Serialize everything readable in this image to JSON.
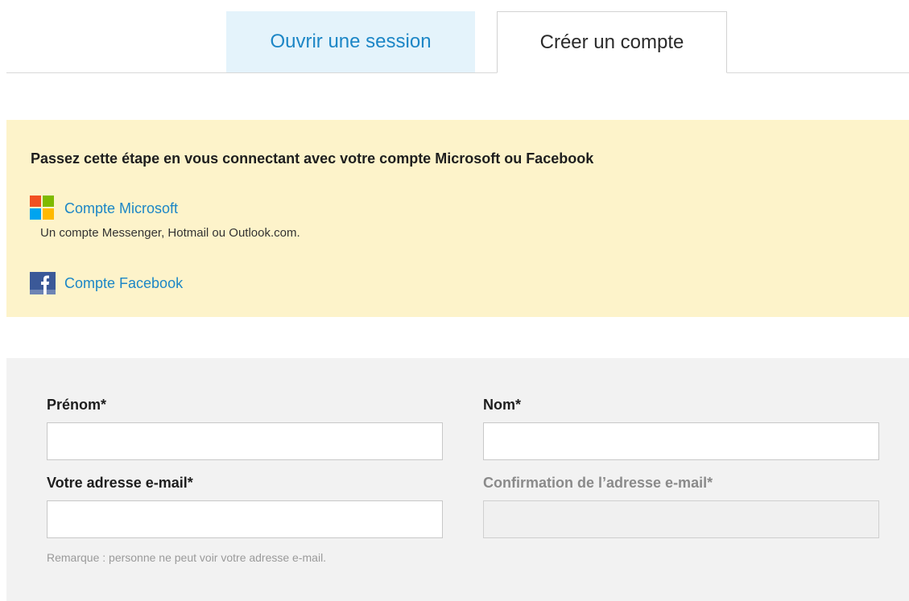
{
  "tabs": {
    "login_label": "Ouvrir une session",
    "create_label": "Créer un compte"
  },
  "social": {
    "heading": "Passez cette étape en vous connectant avec votre compte Microsoft ou Facebook",
    "microsoft": {
      "label": "Compte Microsoft",
      "sublabel": "Un compte Messenger, Hotmail ou Outlook.com.",
      "icon": "microsoft-logo-icon"
    },
    "facebook": {
      "label": "Compte Facebook",
      "icon": "facebook-logo-icon"
    }
  },
  "form": {
    "first_name": {
      "label": "Prénom*",
      "value": ""
    },
    "last_name": {
      "label": "Nom*",
      "value": ""
    },
    "email": {
      "label": "Votre adresse e-mail*",
      "value": ""
    },
    "email_confirm": {
      "label": "Confirmation de l’adresse e-mail*",
      "value": "",
      "disabled": true
    },
    "note": "Remarque : personne ne peut voir votre adresse e-mail."
  },
  "colors": {
    "link": "#1c86c6",
    "active_tab_bg": "#e4f3fb",
    "social_bg": "#fdf3ca",
    "form_bg": "#f2f2f2",
    "ms_red": "#f25022",
    "ms_green": "#7fba00",
    "ms_blue": "#00a4ef",
    "ms_yellow": "#ffb900",
    "fb_blue": "#3b5998"
  }
}
